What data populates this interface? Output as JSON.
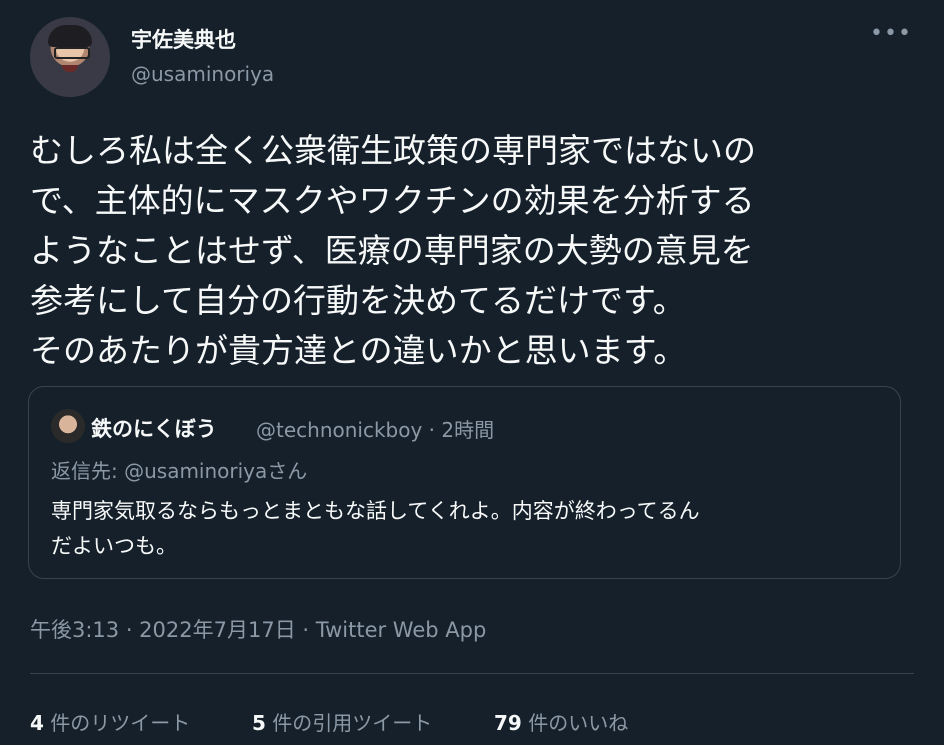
{
  "author": {
    "display_name": "宇佐美典也",
    "handle": "@usaminoriya"
  },
  "tweet": {
    "lines": [
      "むしろ私は全く公衆衛生政策の専門家ではないの",
      "で、主体的にマスクやワクチンの効果を分析する",
      "ようなことはせず、医療の専門家の大勢の意見を",
      "参考にして自分の行動を決めてるだけです。",
      "そのあたりが貴方達との違いかと思います。"
    ],
    "meta": "午後3:13 · 2022年7月17日 · Twitter Web App"
  },
  "quote": {
    "display_name": "鉄のにくぼう",
    "handle_time": "@technonickboy · 2時間",
    "reply_to": "返信先: @usaminoriyaさん",
    "lines": [
      "専門家気取るならもっとまともな話してくれよ。内容が終わってるん",
      "だよいつも。"
    ]
  },
  "stats": {
    "retweets": {
      "count": "4",
      "label": "件のリツイート"
    },
    "quotes": {
      "count": "5",
      "label": "件の引用ツイート"
    },
    "likes": {
      "count": "79",
      "label": "件のいいね"
    }
  },
  "more_icon": "more-horizontal-icon",
  "colors": {
    "background": "#15202b",
    "text": "#f7f9f9",
    "secondary": "#8b98a5",
    "border": "#38444d"
  }
}
